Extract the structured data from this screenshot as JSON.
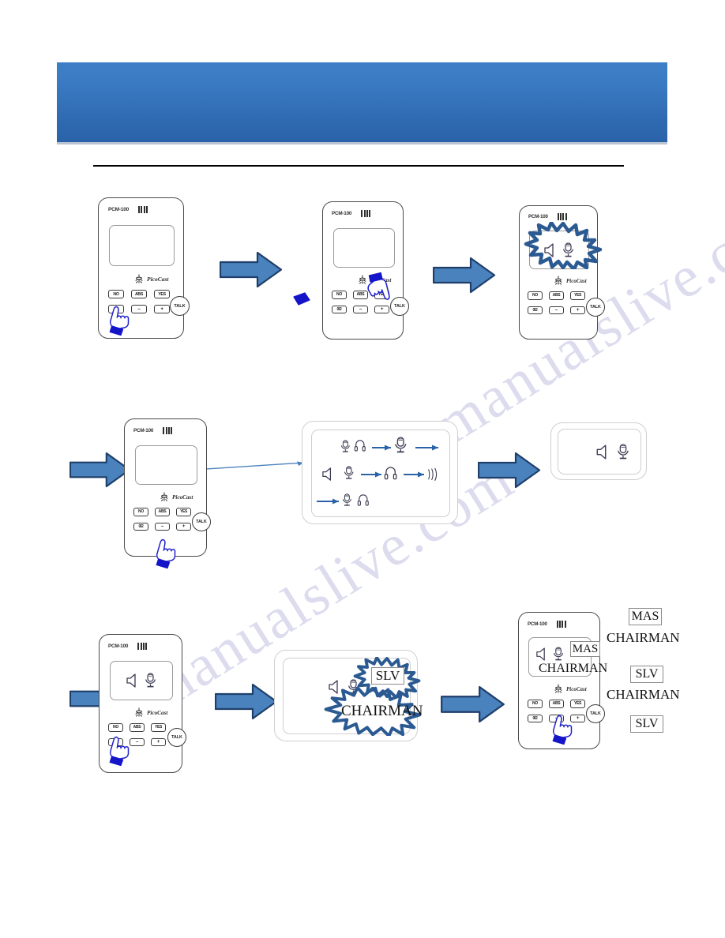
{
  "document": {
    "header_banner": {
      "title": ""
    },
    "watermark_text": "manualslive.com"
  },
  "colors": {
    "banner_top": "#3d7fc6",
    "banner_bottom": "#2a62a8",
    "arrow_fill": "#4a82bd",
    "arrow_stroke": "#1f3f6b",
    "hand_stroke": "#2222cc",
    "hand_cuff": "#1414c8",
    "burst_stroke": "#2b5a92",
    "watermark": "#d6d6ec",
    "device_outline": "#4a4a4a",
    "screen_outline": "#9a9a9a"
  },
  "device": {
    "model": "PCM-100",
    "brand": "PicoCast",
    "signal_bars": 4,
    "keys": {
      "no": "NO",
      "abs": "ABS",
      "yes": "YES",
      "talk": "TALK",
      "menu": "0I2",
      "minus": "–",
      "plus": "+"
    }
  },
  "steps": {
    "row1": {
      "step1": {
        "name": "press-menu-key",
        "screen_icons": [],
        "pressed_key": "0I2"
      },
      "step2": {
        "name": "press-yes-key",
        "screen_icons": [],
        "pressed_key": "YES"
      },
      "step3": {
        "name": "audio-mode-flash",
        "screen_icons": [
          "speaker-icon",
          "microphone-icon"
        ],
        "highlight": "starburst"
      }
    },
    "row2": {
      "step4": {
        "name": "press-plus-key",
        "screen_icons": [],
        "pressed_key": "+"
      },
      "menu_diagram": {
        "name": "audio-routing-menu",
        "rows": [
          {
            "icons": [
              "microphone-icon",
              "headphone-icon"
            ],
            "target": "microphone-icon",
            "has_out_arrow": true
          },
          {
            "icons": [
              "speaker-icon",
              "microphone-icon"
            ],
            "target": "headphone-icon",
            "out_icon": "sound-wave-icon"
          },
          {
            "icons": [
              "microphone-icon",
              "headphone-icon"
            ],
            "has_in_arrow": true
          }
        ]
      },
      "step5": {
        "name": "selected-audio-mode-panel",
        "screen_icons": [
          "speaker-icon",
          "microphone-icon"
        ]
      }
    },
    "row3": {
      "step6": {
        "name": "press-menu-key-again",
        "screen_icons": [
          "speaker-icon",
          "microphone-icon"
        ],
        "pressed_key": "0I2"
      },
      "step7": {
        "name": "role-select-flash",
        "screen_icons": [
          "speaker-icon",
          "microphone-icon"
        ],
        "labels": {
          "mode": "SLV",
          "role": "CHAIRMAN"
        }
      },
      "step8": {
        "name": "press-plus-to-cycle-role",
        "screen_icons": [
          "speaker-icon",
          "microphone-icon"
        ],
        "labels": {
          "mode": "MAS",
          "role": "CHAIRMAN"
        },
        "pressed_key": "+"
      },
      "cycle_list": [
        {
          "type": "box",
          "text": "MAS"
        },
        {
          "type": "text",
          "text": "CHAIRMAN"
        },
        {
          "type": "box",
          "text": "SLV"
        },
        {
          "type": "text",
          "text": "CHAIRMAN"
        },
        {
          "type": "box",
          "text": "SLV"
        }
      ]
    }
  }
}
